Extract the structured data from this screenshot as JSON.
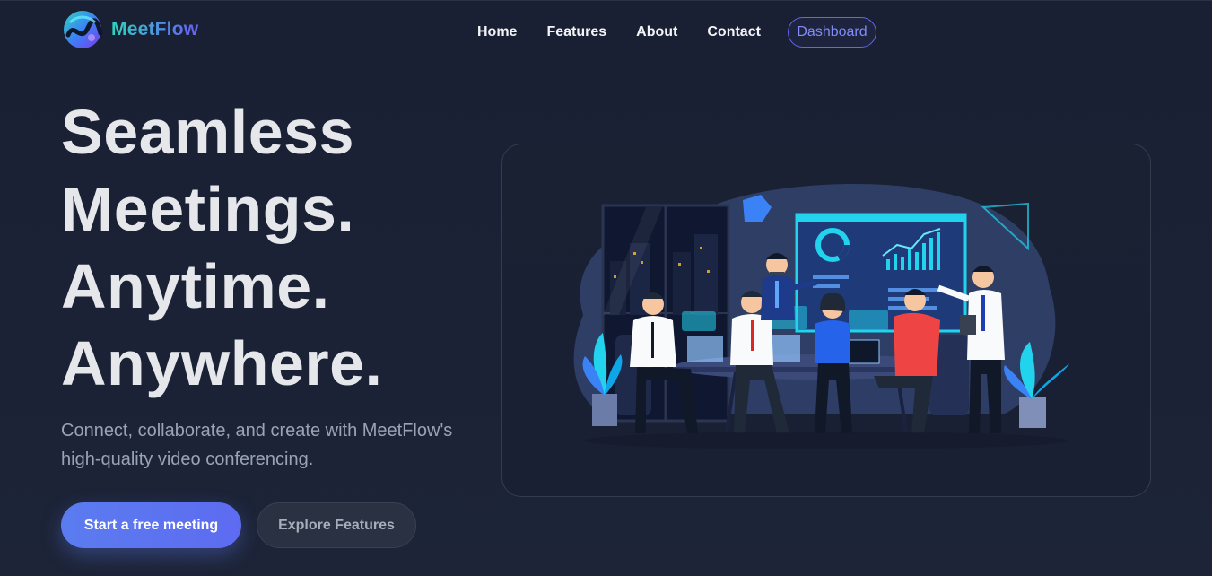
{
  "brand": {
    "name": "MeetFlow",
    "logo_icon": "meetflow-logo-icon"
  },
  "nav": {
    "items": [
      "Home",
      "Features",
      "About",
      "Contact"
    ],
    "dashboard_label": "Dashboard"
  },
  "hero": {
    "title_lines": [
      "Seamless",
      "Meetings.",
      "Anytime.",
      "Anywhere."
    ],
    "subtitle": "Connect, collaborate, and create with MeetFlow's high-quality video conferencing.",
    "primary_cta": "Start a free meeting",
    "secondary_cta": "Explore Features"
  },
  "illustration": {
    "icon": "team-meeting-illustration"
  },
  "colors": {
    "background": "#1b2236",
    "accent": "#6366f1",
    "primary_button": "#5b7cf0",
    "logo_gradient_start": "#2dd4bf",
    "logo_gradient_end": "#6366f1"
  }
}
